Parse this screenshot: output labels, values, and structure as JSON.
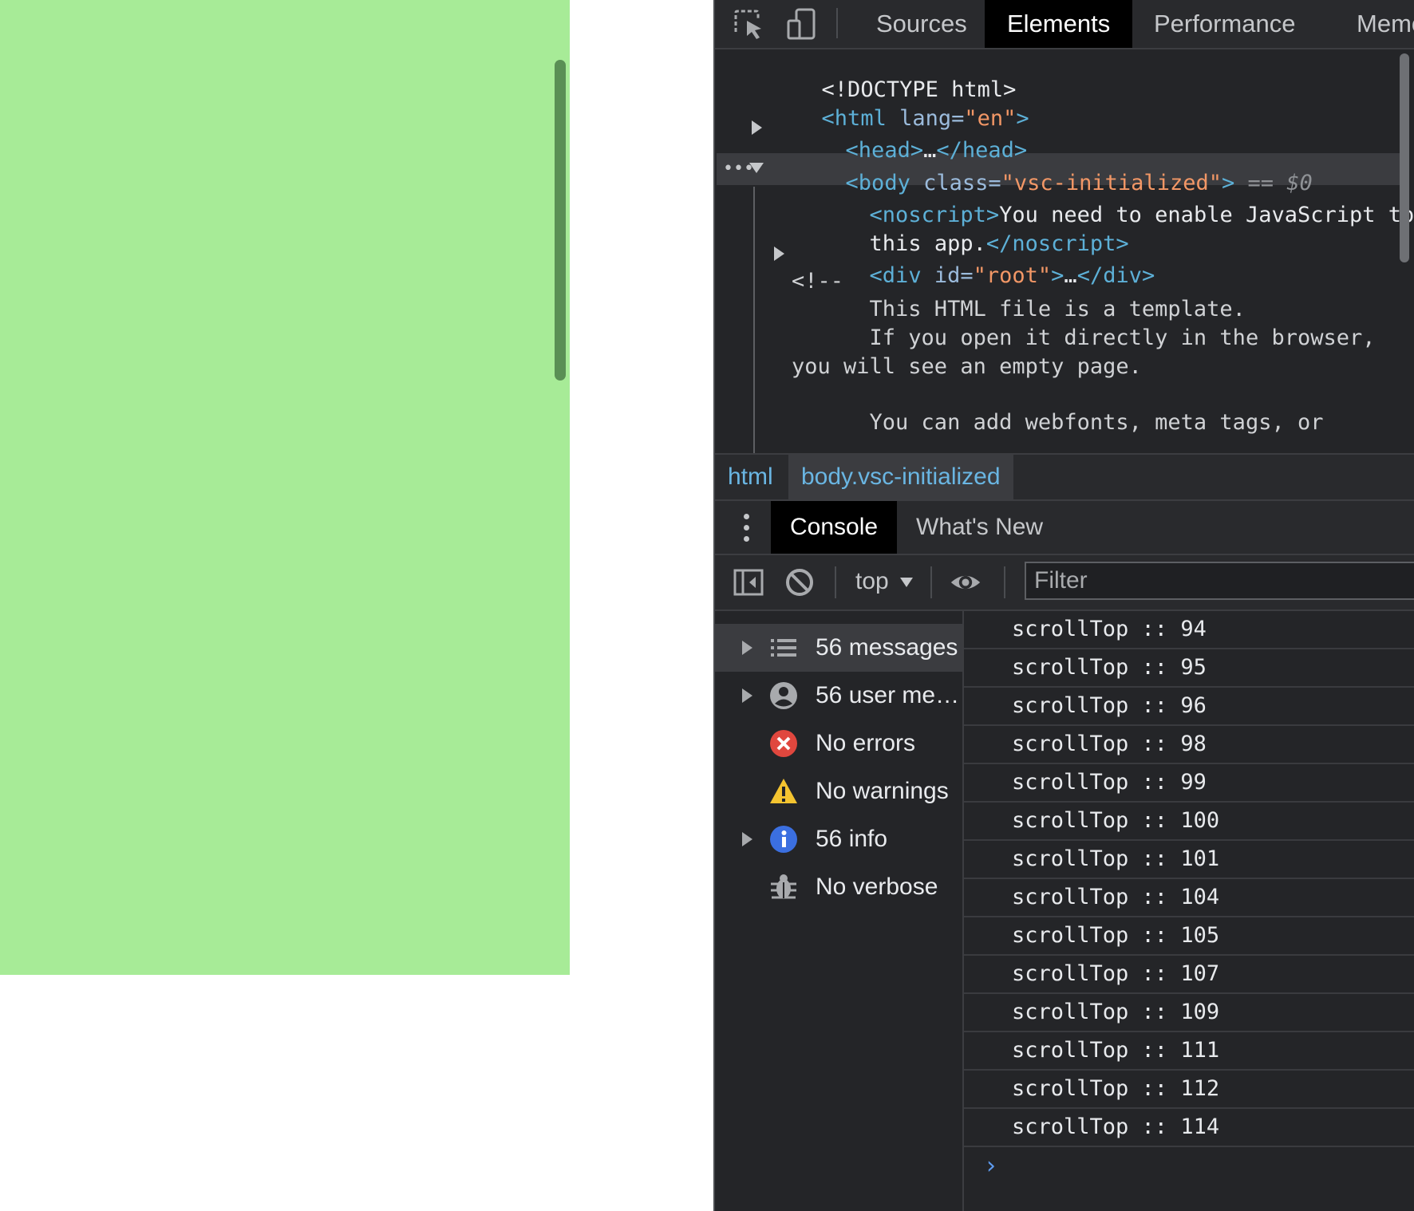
{
  "colors": {
    "page_background": "#a7eb97",
    "devtools_background": "#242528",
    "html_tag": "#5db0d7",
    "attribute_value": "#f29766",
    "error_red": "#e0473e",
    "warning_yellow": "#f4c430",
    "info_blue": "#3b6fe0"
  },
  "devtools": {
    "toolbar": {
      "inspect_icon": "inspect-element-icon",
      "device_icon": "device-toolbar-icon",
      "tabs": [
        {
          "label": "Sources",
          "active": false
        },
        {
          "label": "Elements",
          "active": true
        },
        {
          "label": "Performance",
          "active": false
        },
        {
          "label": "Memor",
          "active": false
        }
      ]
    },
    "elements": {
      "doctype": "<!DOCTYPE html>",
      "html_open": {
        "tag_open": "<html",
        "attr_name": " lang=",
        "attr_value": "\"en\"",
        "tag_close": ">"
      },
      "head": {
        "open": "<head>",
        "ellipsis": "…",
        "close": "</head>"
      },
      "body": {
        "tag_open": "<body",
        "attr_name": " class=",
        "attr_value": "\"vsc-initialized\"",
        "tag_close": ">",
        "selected_marker": " == $0",
        "dots": "•••"
      },
      "noscript": {
        "open": "<noscript>",
        "text_line1": "You need to enable JavaScript to run",
        "text_line2": "this app.",
        "close": "</noscript>"
      },
      "root_div": {
        "tag_open": "<div",
        "attr_name": " id=",
        "attr_value": "\"root\"",
        "tag_close": ">",
        "ellipsis": "…",
        "close": "</div>"
      },
      "comment_lines": [
        "<!--",
        "      This HTML file is a template.",
        "      If you open it directly in the browser,",
        "you will see an empty page.",
        "      You can add webfonts, meta tags, or"
      ]
    },
    "breadcrumb": [
      {
        "label": "html",
        "active": false
      },
      {
        "label": "body.vsc-initialized",
        "active": true
      }
    ],
    "drawer": {
      "menu_icon": "kebab-menu-icon",
      "tabs": [
        {
          "label": "Console",
          "active": true
        },
        {
          "label": "What's New",
          "active": false
        }
      ]
    },
    "console_toolbar": {
      "sidebar_toggle_icon": "sidebar-toggle-icon",
      "clear_icon": "clear-console-icon",
      "context": "top",
      "live_expression_icon": "eye-icon",
      "filter_placeholder": "Filter",
      "filter_value": ""
    },
    "console_sidebar": [
      {
        "label": "56 messages",
        "icon": "list-icon",
        "expandable": true,
        "active": true
      },
      {
        "label": "56 user me…",
        "icon": "user-icon",
        "expandable": true,
        "active": false
      },
      {
        "label": "No errors",
        "icon": "error-icon",
        "expandable": false,
        "active": false
      },
      {
        "label": "No warnings",
        "icon": "warning-icon",
        "expandable": false,
        "active": false
      },
      {
        "label": "56 info",
        "icon": "info-icon",
        "expandable": true,
        "active": false
      },
      {
        "label": "No verbose",
        "icon": "bug-icon",
        "expandable": false,
        "active": false
      }
    ],
    "console_messages": [
      "scrollTop :: 94",
      "scrollTop :: 95",
      "scrollTop :: 96",
      "scrollTop :: 98",
      "scrollTop :: 99",
      "scrollTop :: 100",
      "scrollTop :: 101",
      "scrollTop :: 104",
      "scrollTop :: 105",
      "scrollTop :: 107",
      "scrollTop :: 109",
      "scrollTop :: 111",
      "scrollTop :: 112",
      "scrollTop :: 114"
    ],
    "prompt_glyph": "›"
  }
}
